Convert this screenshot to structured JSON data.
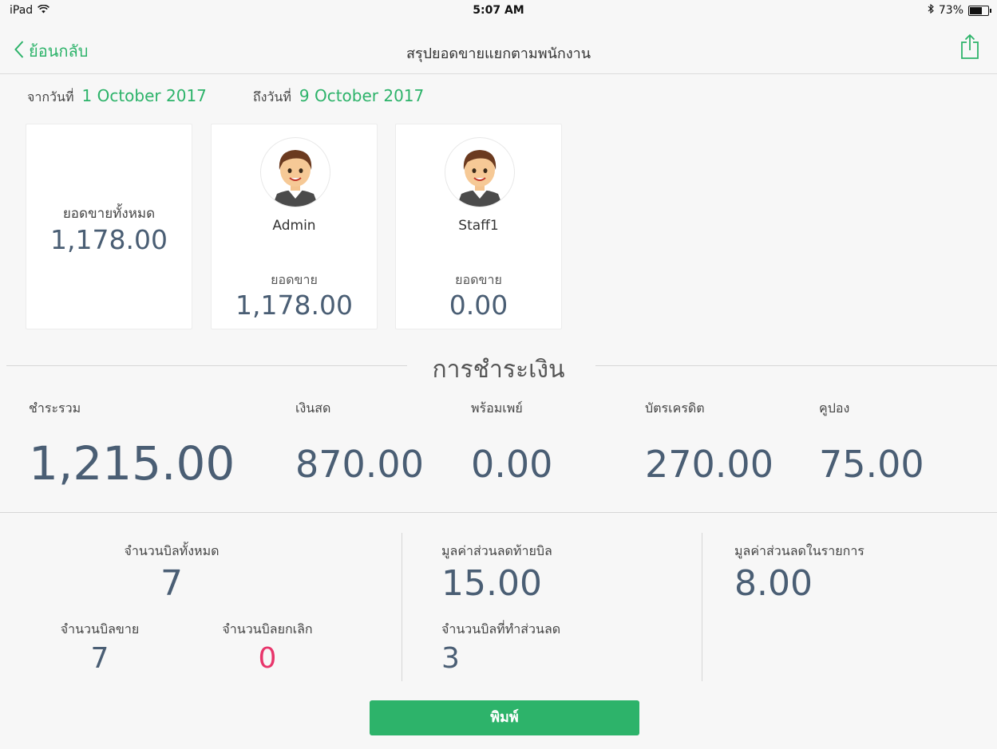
{
  "status": {
    "device": "iPad",
    "time": "5:07 AM",
    "battery": "73%"
  },
  "nav": {
    "back_label": "ย้อนกลับ",
    "title": "สรุปยอดขายแยกตามพนักงาน"
  },
  "dates": {
    "from_label": "จากวันที่",
    "from_value": "1 October 2017",
    "to_label": "ถึงวันที่",
    "to_value": "9 October 2017"
  },
  "cards": {
    "total": {
      "label": "ยอดขายทั้งหมด",
      "value": "1,178.00"
    },
    "admin": {
      "name": "Admin",
      "sale_label": "ยอดขาย",
      "sale_value": "1,178.00"
    },
    "staff": {
      "name": "Staff1",
      "sale_label": "ยอดขาย",
      "sale_value": "0.00"
    }
  },
  "payment": {
    "section_title": "การชำระเงิน",
    "total": {
      "label": "ชำระรวม",
      "value": "1,215.00"
    },
    "cash": {
      "label": "เงินสด",
      "value": "870.00"
    },
    "promptpay": {
      "label": "พร้อมเพย์",
      "value": "0.00"
    },
    "credit": {
      "label": "บัตรเครดิต",
      "value": "270.00"
    },
    "coupon": {
      "label": "คูปอง",
      "value": "75.00"
    }
  },
  "bills": {
    "total": {
      "label": "จำนวนบิลทั้งหมด",
      "value": "7"
    },
    "sale": {
      "label": "จำนวนบิลขาย",
      "value": "7"
    },
    "cancel": {
      "label": "จำนวนบิลยกเลิก",
      "value": "0"
    },
    "bill_discount": {
      "label": "มูลค่าส่วนลดท้ายบิล",
      "value": "15.00"
    },
    "discount_bills": {
      "label": "จำนวนบิลที่ทำส่วนลด",
      "value": "3"
    },
    "item_discount": {
      "label": "มูลค่าส่วนลดในรายการ",
      "value": "8.00"
    }
  },
  "print_button": "พิมพ์",
  "colors": {
    "accent": "#2db36a",
    "value_text": "#4a5e74",
    "cancel_red": "#e8356b"
  }
}
